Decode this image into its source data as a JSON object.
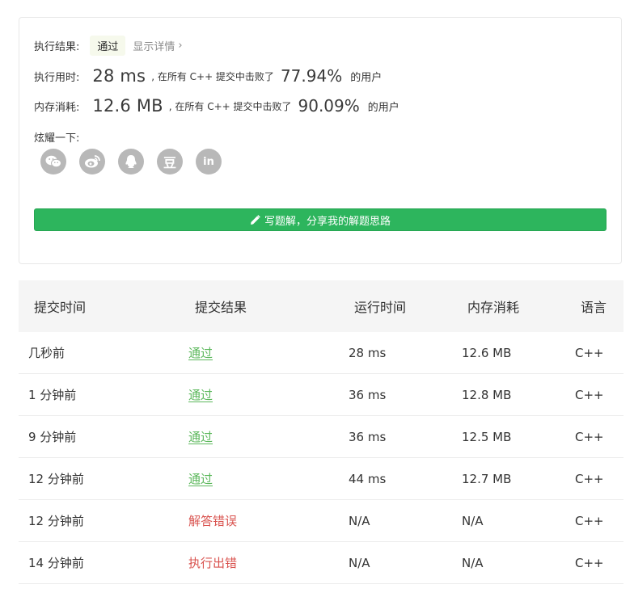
{
  "result": {
    "label": "执行结果:",
    "status": "通过",
    "detail_link": "显示详情",
    "detail_chevron": "›"
  },
  "runtime": {
    "label": "执行用时:",
    "value": "28 ms",
    "mid_text": ", 在所有 C++ 提交中击败了",
    "percent": "77.94%",
    "suffix": "的用户"
  },
  "memory": {
    "label": "内存消耗:",
    "value": "12.6 MB",
    "mid_text": ", 在所有 C++ 提交中击败了",
    "percent": "90.09%",
    "suffix": "的用户"
  },
  "share": {
    "label": "炫耀一下:",
    "icons": [
      "wechat-icon",
      "weibo-icon",
      "qq-icon",
      "douban-icon",
      "linkedin-icon"
    ],
    "douban_glyph": "豆",
    "linkedin_glyph": "in"
  },
  "write_solution": {
    "label": "写题解，分享我的解题思路",
    "icon": "pencil-icon"
  },
  "colors": {
    "accent_green": "#2db55d",
    "pass_green": "#5cb85c",
    "error_red": "#d9534f"
  },
  "table": {
    "headers": [
      "提交时间",
      "提交结果",
      "运行时间",
      "内存消耗",
      "语言"
    ],
    "rows": [
      {
        "time": "几秒前",
        "result": "通过",
        "runtime": "28 ms",
        "memory": "12.6 MB",
        "lang": "C++"
      },
      {
        "time": "1 分钟前",
        "result": "通过",
        "runtime": "36 ms",
        "memory": "12.8 MB",
        "lang": "C++"
      },
      {
        "time": "9 分钟前",
        "result": "通过",
        "runtime": "36 ms",
        "memory": "12.5 MB",
        "lang": "C++"
      },
      {
        "time": "12 分钟前",
        "result": "通过",
        "runtime": "44 ms",
        "memory": "12.7 MB",
        "lang": "C++"
      },
      {
        "time": "12 分钟前",
        "result": "解答错误",
        "runtime": "N/A",
        "memory": "N/A",
        "lang": "C++"
      },
      {
        "time": "14 分钟前",
        "result": "执行出错",
        "runtime": "N/A",
        "memory": "N/A",
        "lang": "C++"
      }
    ]
  }
}
